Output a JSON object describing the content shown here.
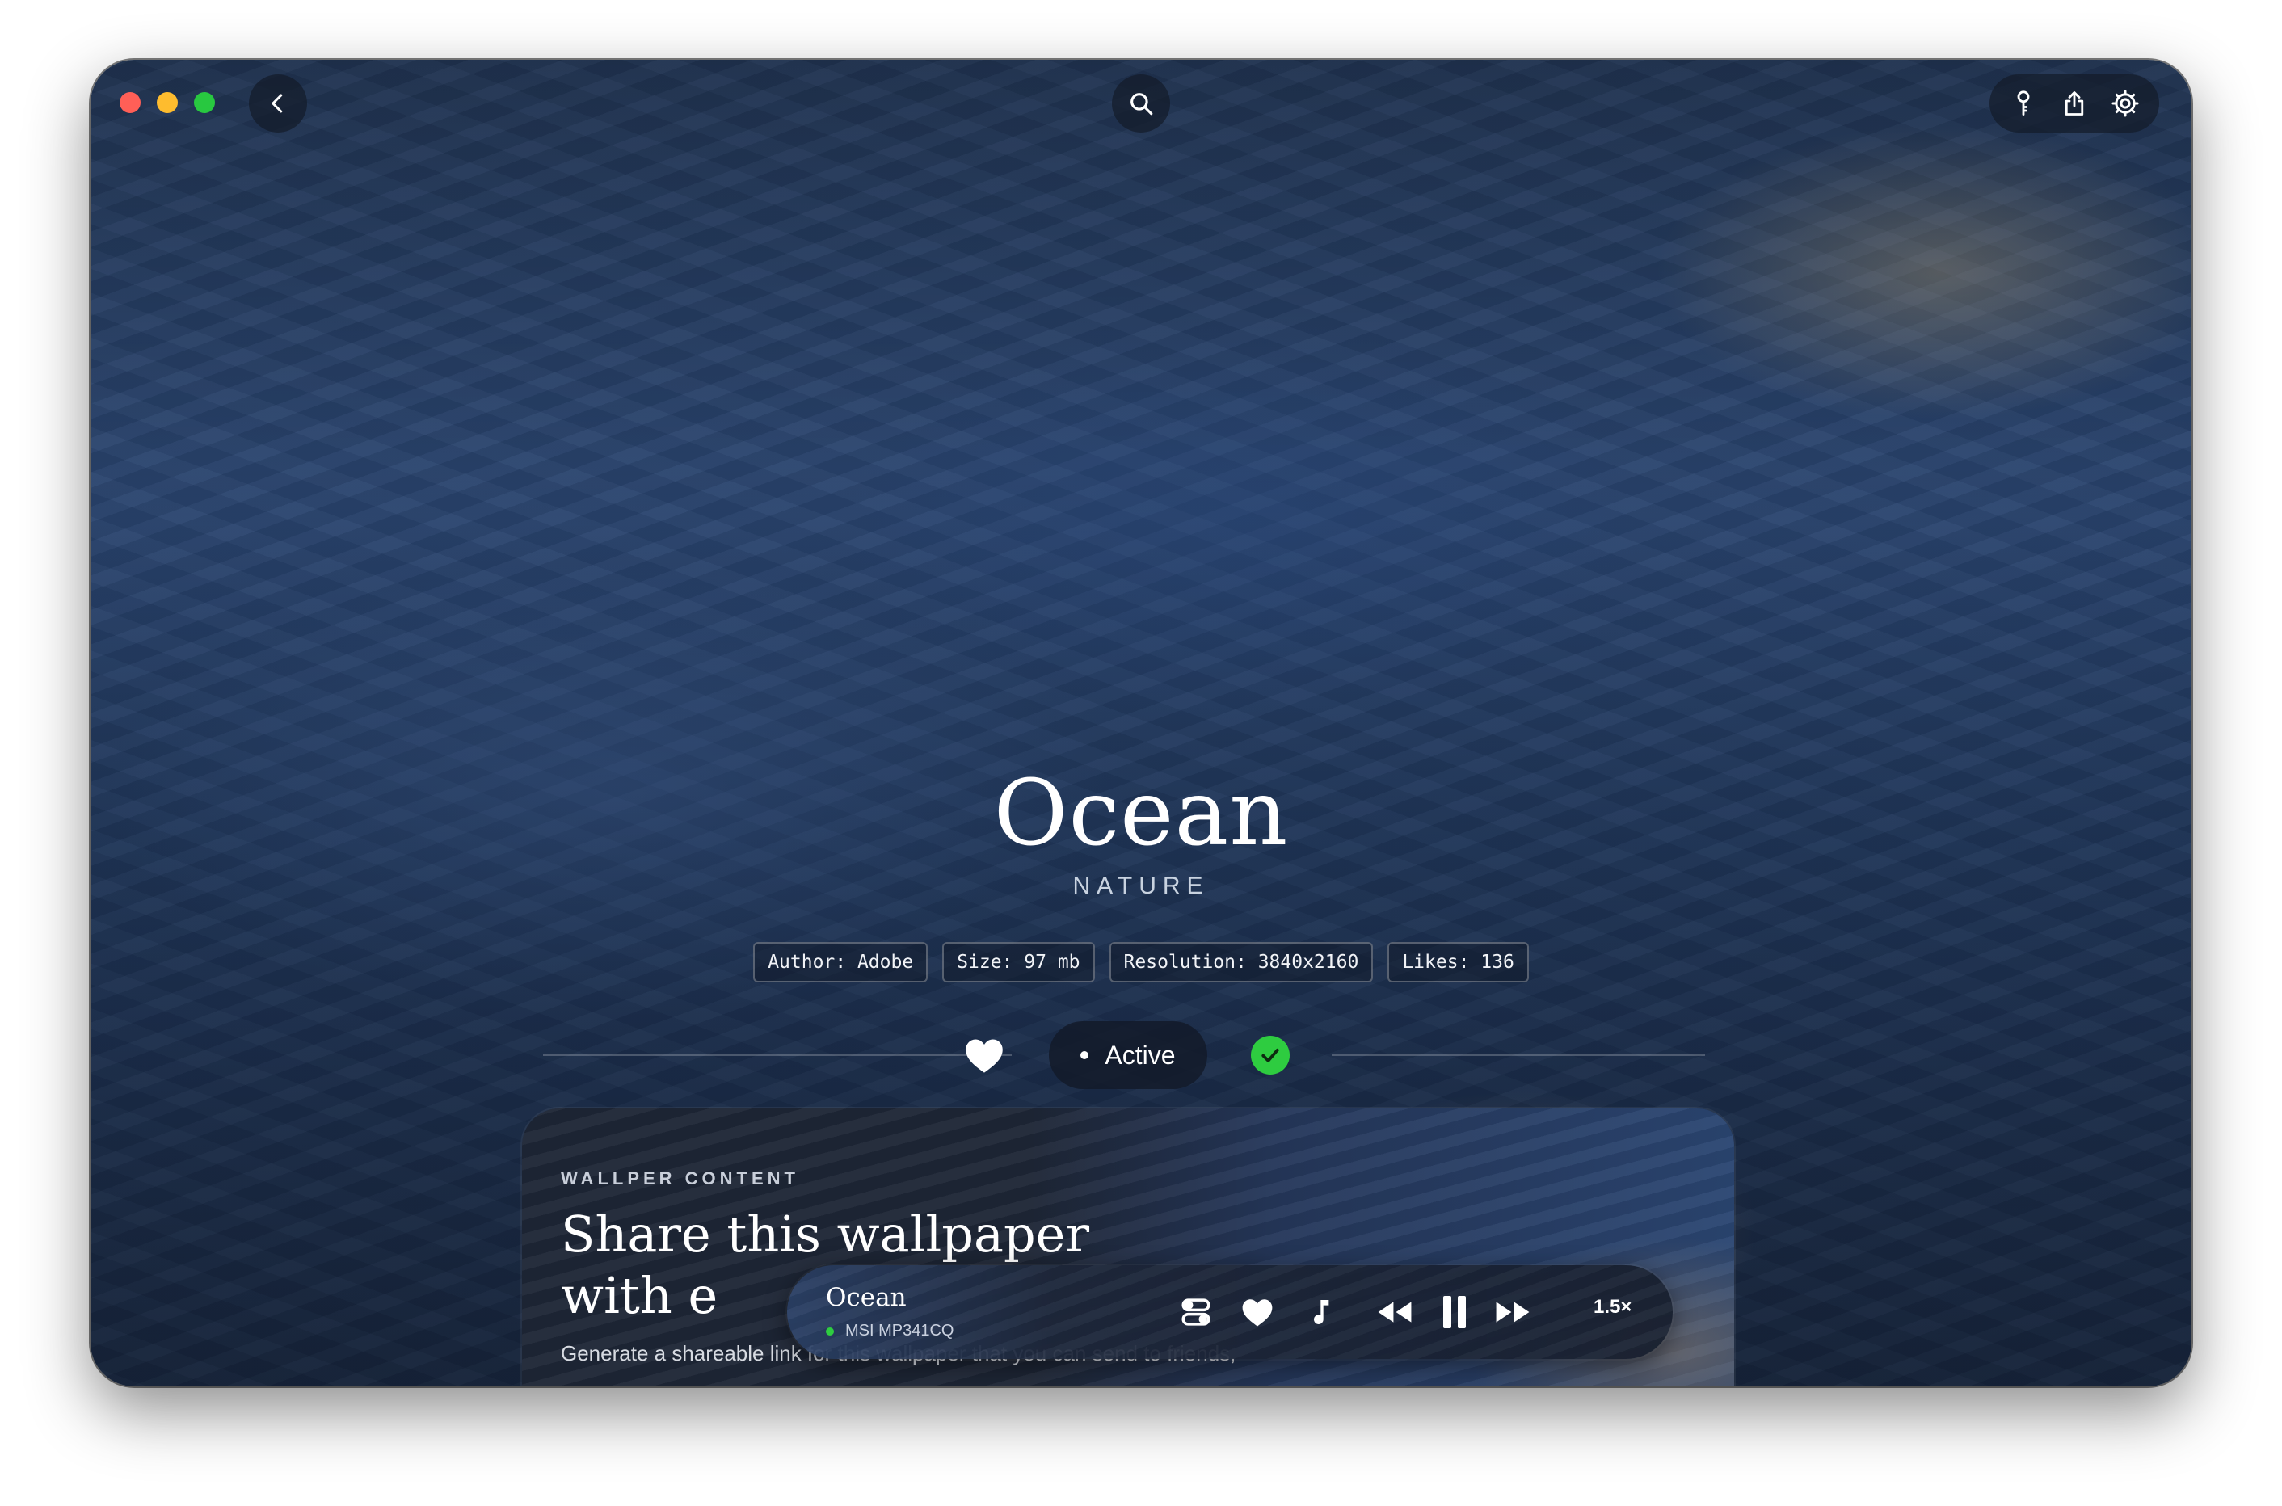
{
  "window": {
    "controls": [
      "close",
      "minimize",
      "maximize"
    ]
  },
  "toolbar": {
    "back_icon": "chevron-left-icon",
    "search_icon": "search-icon",
    "right_icons": [
      "key-icon",
      "share-icon",
      "gear-icon"
    ]
  },
  "wallpaper": {
    "title": "Ocean",
    "category": "NATURE",
    "tags": [
      "Author: Adobe",
      "Size: 97 mb",
      "Resolution: 3840x2160",
      "Likes: 136"
    ],
    "status_label": "Active"
  },
  "content_card": {
    "section_label": "WALLPER CONTENT",
    "heading": "Share this wallpaper with e",
    "description": "Generate a shareable link for this wallpaper that you can send to friends,"
  },
  "player": {
    "title": "Ocean",
    "device": "MSI MP341CQ",
    "speed": "1.5×"
  },
  "colors": {
    "accent_green": "#2ecc40",
    "traffic_red": "#ff5f57",
    "traffic_yellow": "#febc2e",
    "traffic_green": "#28c840"
  }
}
